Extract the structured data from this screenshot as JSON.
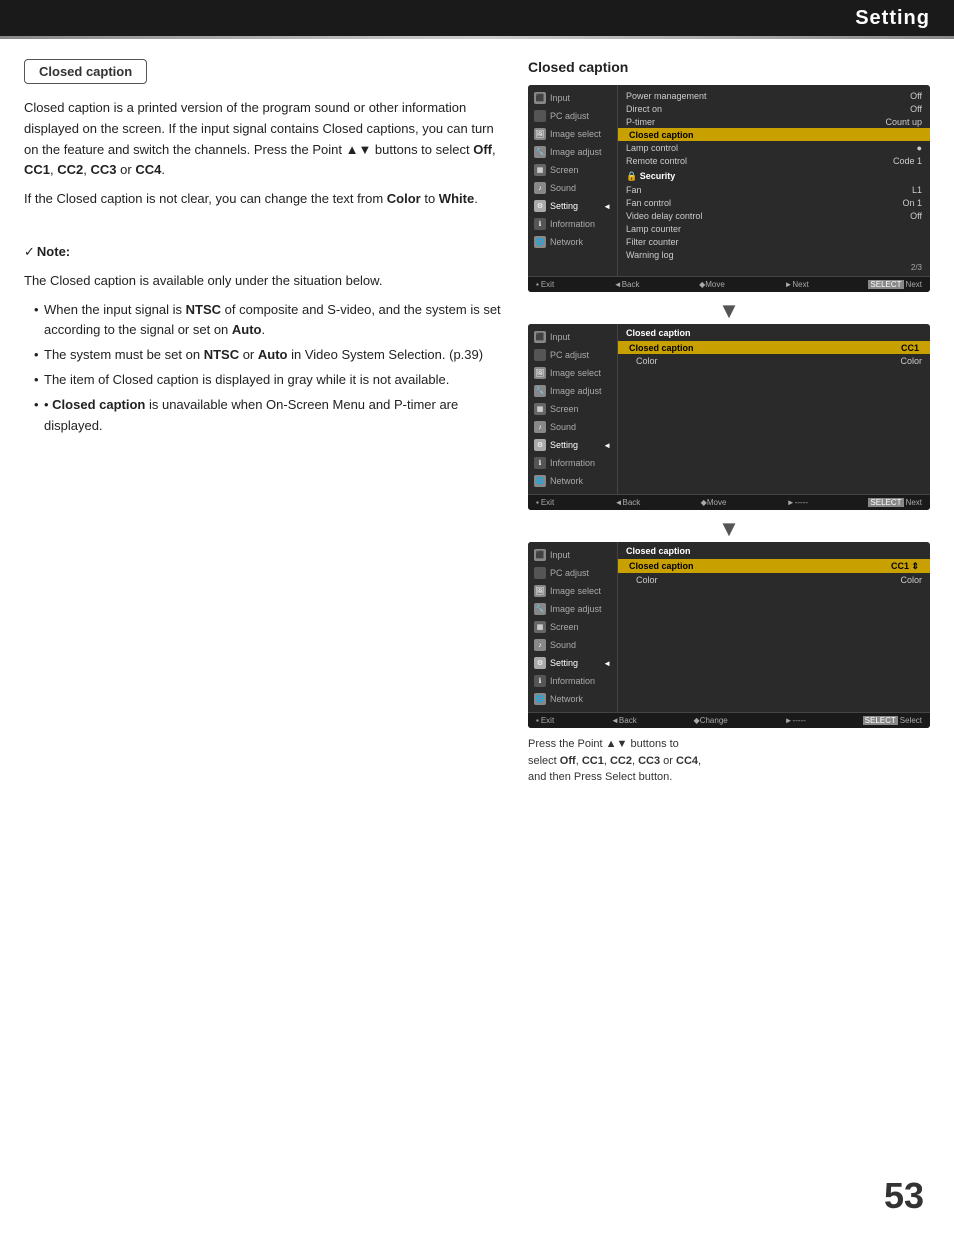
{
  "header": {
    "title": "Setting",
    "line_color": "#888"
  },
  "page_number": "53",
  "badge": {
    "label": "Closed caption"
  },
  "left": {
    "paragraph1": "Closed caption is a printed version of the program sound or other information displayed on the screen. If the input signal contains Closed captions, you can turn on the feature and switch the channels. Press the Point ▲▼ buttons to select ",
    "paragraph1_bold1": "Off",
    "paragraph1_mid": ", ",
    "paragraph1_bold2": "CC1",
    "paragraph1_mid2": ", ",
    "paragraph1_bold3": "CC2",
    "paragraph1_mid3": ", ",
    "paragraph1_bold4": "CC3",
    "paragraph1_mid4": " or ",
    "paragraph1_bold5": "CC4",
    "paragraph1_end": ".",
    "paragraph2_pre": "If the Closed caption is not clear, you can change the text from ",
    "paragraph2_bold1": "Color",
    "paragraph2_mid": " to ",
    "paragraph2_bold2": "White",
    "paragraph2_end": ".",
    "note_title": "Note:",
    "note_intro": "The Closed caption is available only under the situation below.",
    "note_items": [
      "When the input signal is NTSC of composite and S-video, and the system is set according to the signal or set on Auto.",
      "The system must be set on NTSC or Auto in Video System Selection. (p.39)",
      "The item of Closed caption is displayed in gray while it is not available.",
      "Closed caption is unavailable when On-Screen Menu and P-timer are displayed."
    ]
  },
  "right": {
    "section_title": "Closed caption",
    "panel1": {
      "sidebar_items": [
        {
          "label": "Input",
          "active": false
        },
        {
          "label": "PC adjust",
          "active": false
        },
        {
          "label": "Image select",
          "active": false
        },
        {
          "label": "Image adjust",
          "active": false
        },
        {
          "label": "Screen",
          "active": false
        },
        {
          "label": "Sound",
          "active": false
        },
        {
          "label": "Setting",
          "active": true
        },
        {
          "label": "Information",
          "active": false
        },
        {
          "label": "Network",
          "active": false
        }
      ],
      "main_rows": [
        {
          "label": "Power management",
          "value": "Off",
          "highlighted": false
        },
        {
          "label": "Direct on",
          "value": "Off",
          "highlighted": false
        },
        {
          "label": "P-timer",
          "value": "Count up",
          "highlighted": false
        },
        {
          "label": "Closed caption",
          "value": "",
          "highlighted": true
        },
        {
          "label": "Lamp control",
          "value": "●",
          "highlighted": false
        },
        {
          "label": "Remote control",
          "value": "Code 1",
          "highlighted": false
        },
        {
          "label": "Security",
          "value": "",
          "highlighted": false
        },
        {
          "label": "Fan",
          "value": "L1",
          "highlighted": false
        },
        {
          "label": "Fan control",
          "value": "On 1",
          "highlighted": false
        },
        {
          "label": "Video delay control",
          "value": "Off",
          "highlighted": false
        },
        {
          "label": "Lamp counter",
          "value": "",
          "highlighted": false
        },
        {
          "label": "Filter counter",
          "value": "",
          "highlighted": false
        },
        {
          "label": "Warning log",
          "value": "",
          "highlighted": false
        }
      ],
      "page_indicator": "2/3",
      "footer": [
        "MENU Exit",
        "◄Back",
        "◆Move",
        "►Next",
        "SELECT Next"
      ]
    },
    "panel2": {
      "main_title": "Closed caption",
      "rows": [
        {
          "label": "Closed caption",
          "value": "CC1",
          "highlighted": true
        },
        {
          "label": "Color",
          "value": "Color",
          "highlighted": false
        }
      ],
      "footer": [
        "MENU Exit",
        "◄Back",
        "◆Move",
        "►-----",
        "SELECT Next"
      ]
    },
    "panel3": {
      "main_title": "Closed caption",
      "rows": [
        {
          "label": "Closed caption",
          "value": "CC1 ⇕",
          "highlighted": true
        },
        {
          "label": "Color",
          "value": "Color",
          "highlighted": false
        }
      ],
      "footer": [
        "MENU Exit",
        "◄Back",
        "◆Change",
        "►-----",
        "SELECT Select"
      ]
    },
    "caption": {
      "line1": "Press the Point ▲▼ buttons to",
      "line2": "select Off, CC1, CC2, CC3 or CC4,",
      "line3": "and then Press Select button."
    }
  }
}
